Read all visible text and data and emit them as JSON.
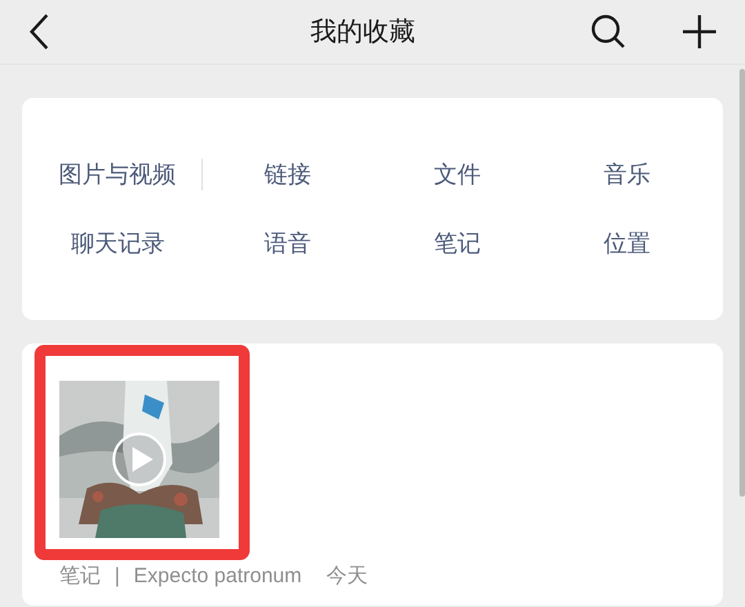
{
  "header": {
    "title": "我的收藏"
  },
  "categories": [
    [
      "图片与视频",
      "链接",
      "文件",
      "音乐"
    ],
    [
      "聊天记录",
      "语音",
      "笔记",
      "位置"
    ]
  ],
  "items": [
    {
      "kind": "video",
      "highlighted": true,
      "type_label": "笔记",
      "separator": "|",
      "source": "Expecto patronum",
      "time": "今天"
    }
  ]
}
